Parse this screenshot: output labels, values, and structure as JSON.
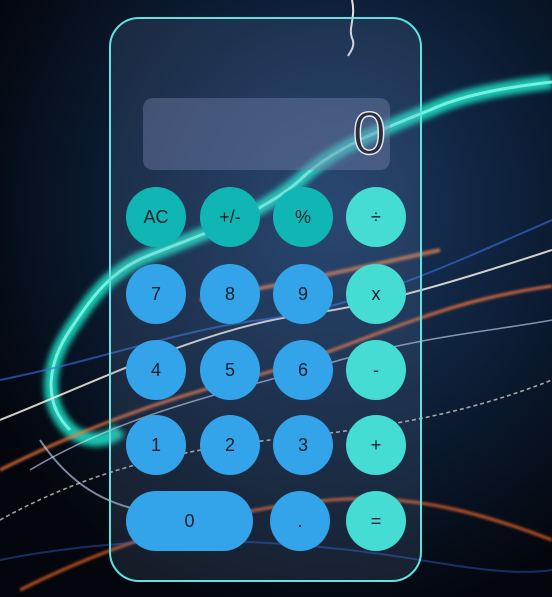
{
  "display": {
    "value": "0"
  },
  "keys": {
    "clear": "AC",
    "sign": "+/-",
    "percent": "%",
    "divide": "÷",
    "seven": "7",
    "eight": "8",
    "nine": "9",
    "multiply": "x",
    "four": "4",
    "five": "5",
    "six": "6",
    "subtract": "-",
    "one": "1",
    "two": "2",
    "three": "3",
    "add": "+",
    "zero": "0",
    "decimal": ".",
    "equals": "="
  },
  "colors": {
    "function_keys": "#0fb6b4",
    "number_keys": "#33a3ea",
    "operator_keys": "#44dcd3",
    "frame_border": "#5fe3e0"
  }
}
